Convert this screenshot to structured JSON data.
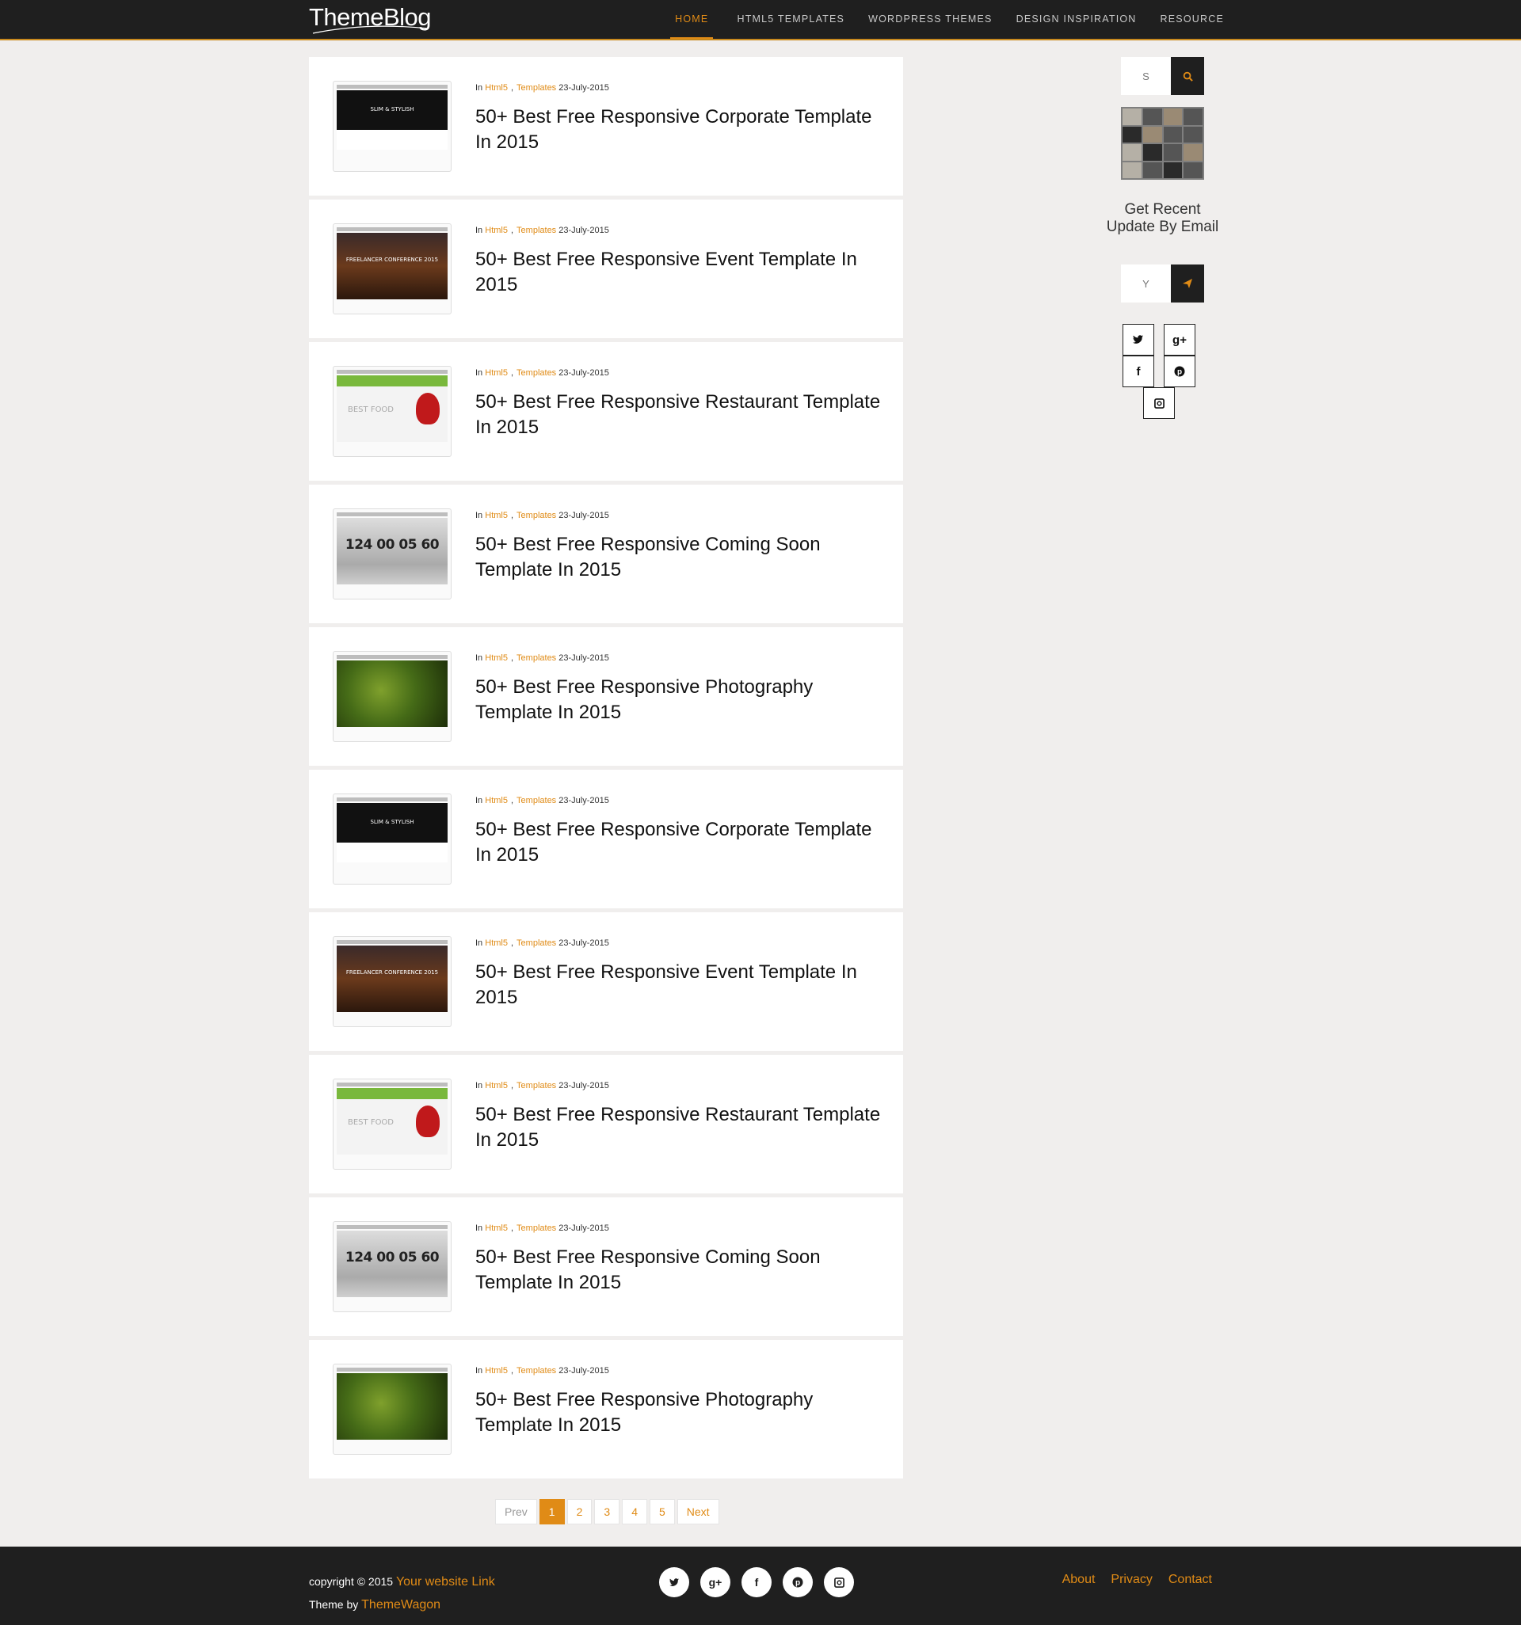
{
  "header": {
    "logo": "ThemeBlog",
    "nav": [
      "HOME",
      "HTML5 TEMPLATES",
      "WORDPRESS THEMES",
      "DESIGN INSPIRATION",
      "RESOURCE"
    ]
  },
  "posts": [
    {
      "in": "In",
      "cat1": "Html5",
      "sep": ",",
      "cat2": "Templates",
      "date": "23-July-2015",
      "title": "50+ Best Free Responsive Corporate Template In 2015",
      "thumb_text": "SLIM & STYLISH"
    },
    {
      "in": "In",
      "cat1": "Html5",
      "sep": ",",
      "cat2": "Templates",
      "date": "23-July-2015",
      "title": "50+ Best Free Responsive Event Template In 2015",
      "thumb_text": "FREELANCER CONFERENCE 2015"
    },
    {
      "in": "In",
      "cat1": "Html5",
      "sep": ",",
      "cat2": "Templates",
      "date": "23-July-2015",
      "title": "50+ Best Free Responsive Restaurant Template In 2015",
      "thumb_text": "BEST FOOD"
    },
    {
      "in": "In",
      "cat1": "Html5",
      "sep": ",",
      "cat2": "Templates",
      "date": "23-July-2015",
      "title": "50+ Best Free Responsive Coming Soon Template In 2015",
      "thumb_text": "124 00 05 60"
    },
    {
      "in": "In",
      "cat1": "Html5",
      "sep": ",",
      "cat2": "Templates",
      "date": "23-July-2015",
      "title": "50+ Best Free Responsive Photography Template In 2015",
      "thumb_text": ""
    },
    {
      "in": "In",
      "cat1": "Html5",
      "sep": ",",
      "cat2": "Templates",
      "date": "23-July-2015",
      "title": "50+ Best Free Responsive Corporate Template In 2015",
      "thumb_text": "SLIM & STYLISH"
    },
    {
      "in": "In",
      "cat1": "Html5",
      "sep": ",",
      "cat2": "Templates",
      "date": "23-July-2015",
      "title": "50+ Best Free Responsive Event Template In 2015",
      "thumb_text": "FREELANCER CONFERENCE 2015"
    },
    {
      "in": "In",
      "cat1": "Html5",
      "sep": ",",
      "cat2": "Templates",
      "date": "23-July-2015",
      "title": "50+ Best Free Responsive Restaurant Template In 2015",
      "thumb_text": "BEST FOOD"
    },
    {
      "in": "In",
      "cat1": "Html5",
      "sep": ",",
      "cat2": "Templates",
      "date": "23-July-2015",
      "title": "50+ Best Free Responsive Coming Soon Template In 2015",
      "thumb_text": "124 00 05 60"
    },
    {
      "in": "In",
      "cat1": "Html5",
      "sep": ",",
      "cat2": "Templates",
      "date": "23-July-2015",
      "title": "50+ Best Free Responsive Photography Template In 2015",
      "thumb_text": ""
    }
  ],
  "pagination": {
    "prev": "Prev",
    "pages": [
      "1",
      "2",
      "3",
      "4",
      "5"
    ],
    "next": "Next",
    "current": "1"
  },
  "sidebar": {
    "search_placeholder": "S",
    "subscribe_heading": "Get Recent Update By Email",
    "email_placeholder": "Y"
  },
  "footer": {
    "copyright": "copyright © 2015",
    "website_link": "Your website Link",
    "theme_by": "Theme by",
    "themewagon": "ThemeWagon",
    "links": [
      "About",
      "Privacy",
      "Contact"
    ]
  },
  "icons": {
    "search": "search-icon",
    "send": "paper-plane-icon",
    "social": [
      "twitter-icon",
      "google-plus-icon",
      "facebook-icon",
      "pinterest-icon",
      "instagram-icon"
    ]
  },
  "colors": {
    "accent": "#e08b16",
    "dark": "#1f1f1f",
    "background": "#f0eeed"
  }
}
